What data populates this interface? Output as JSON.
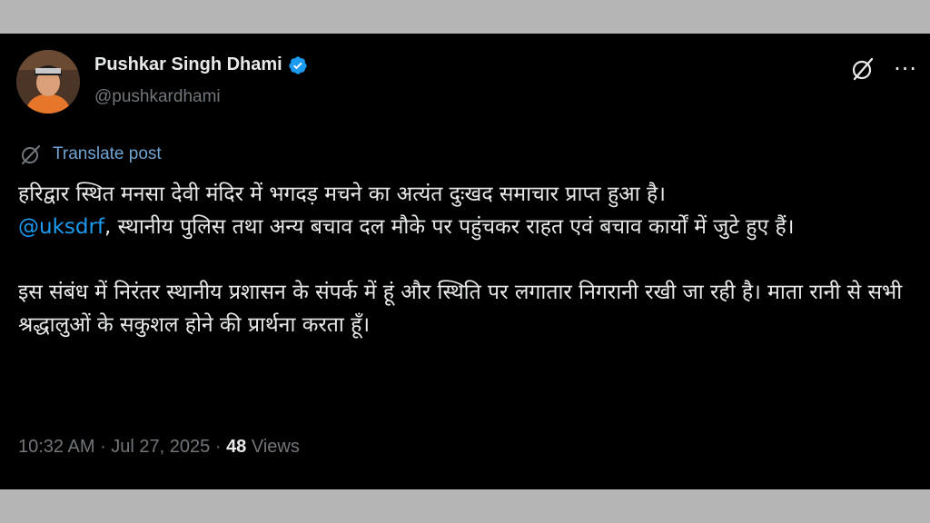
{
  "author": {
    "name": "Pushkar Singh Dhami",
    "handle": "@pushkardhami",
    "verified": true,
    "verified_color": "#1d9bf0"
  },
  "actions": {
    "grok_icon": "grok-icon",
    "more_label": "···"
  },
  "translate_label": "Translate post",
  "post": {
    "line1": "हरिद्वार स्थित मनसा देवी मंदिर में भगदड़ मचने का अत्यंत दुःखद समाचार प्राप्त हुआ है।",
    "mention": "@uksdrf",
    "line2_rest": ", स्थानीय पुलिस तथा अन्य बचाव दल मौके पर पहुंचकर राहत एवं बचाव कार्यों में जुटे हुए हैं।",
    "paragraph2": "इस संबंध में निरंतर स्थानीय प्रशासन के संपर्क में हूं और स्थिति पर लगातार निगरानी रखी जा रही है। माता रानी से सभी श्रद्धालुओं के सकुशल होने की प्रार्थना करता हूँ।"
  },
  "meta": {
    "time": "10:32 AM",
    "separator": " · ",
    "date": "Jul 27, 2025",
    "views_count": "48",
    "views_label": " Views"
  },
  "colors": {
    "background": "#000000",
    "text": "#e7e9ea",
    "muted": "#71767b",
    "link": "#1d9bf0",
    "translate": "#6fa3d2"
  }
}
